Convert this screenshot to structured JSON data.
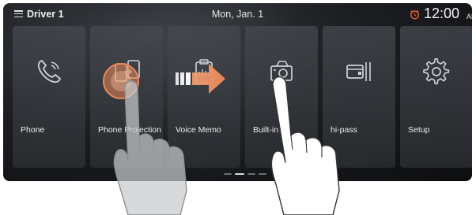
{
  "statusbar": {
    "driver": "Driver 1",
    "date": "Mon, Jan. 1",
    "time": "12:00",
    "ampm": "AM",
    "menu_icon": "hamburger-menu-icon",
    "alarm_icon": "alarm-clock-icon",
    "alarm_color": "#e05a3a"
  },
  "tiles": [
    {
      "label": "Phone",
      "icon": "phone-icon"
    },
    {
      "label": "Phone Projection",
      "icon": "phone-projection-icon"
    },
    {
      "label": "Voice Memo",
      "icon": "voice-memo-icon"
    },
    {
      "label": "Built-in",
      "icon": "camera-icon"
    },
    {
      "label": "hi-pass",
      "icon": "hi-pass-card-icon"
    },
    {
      "label": "Setup",
      "icon": "gear-icon"
    }
  ],
  "pager": {
    "pages": 4,
    "active": 1
  },
  "gesture": {
    "type": "drag",
    "direction": "right",
    "arrow_color": "#f0a070",
    "touch_color": "#e8875a"
  },
  "colors": {
    "icon": "#cfd3d8",
    "tile": "#3c3f44"
  }
}
